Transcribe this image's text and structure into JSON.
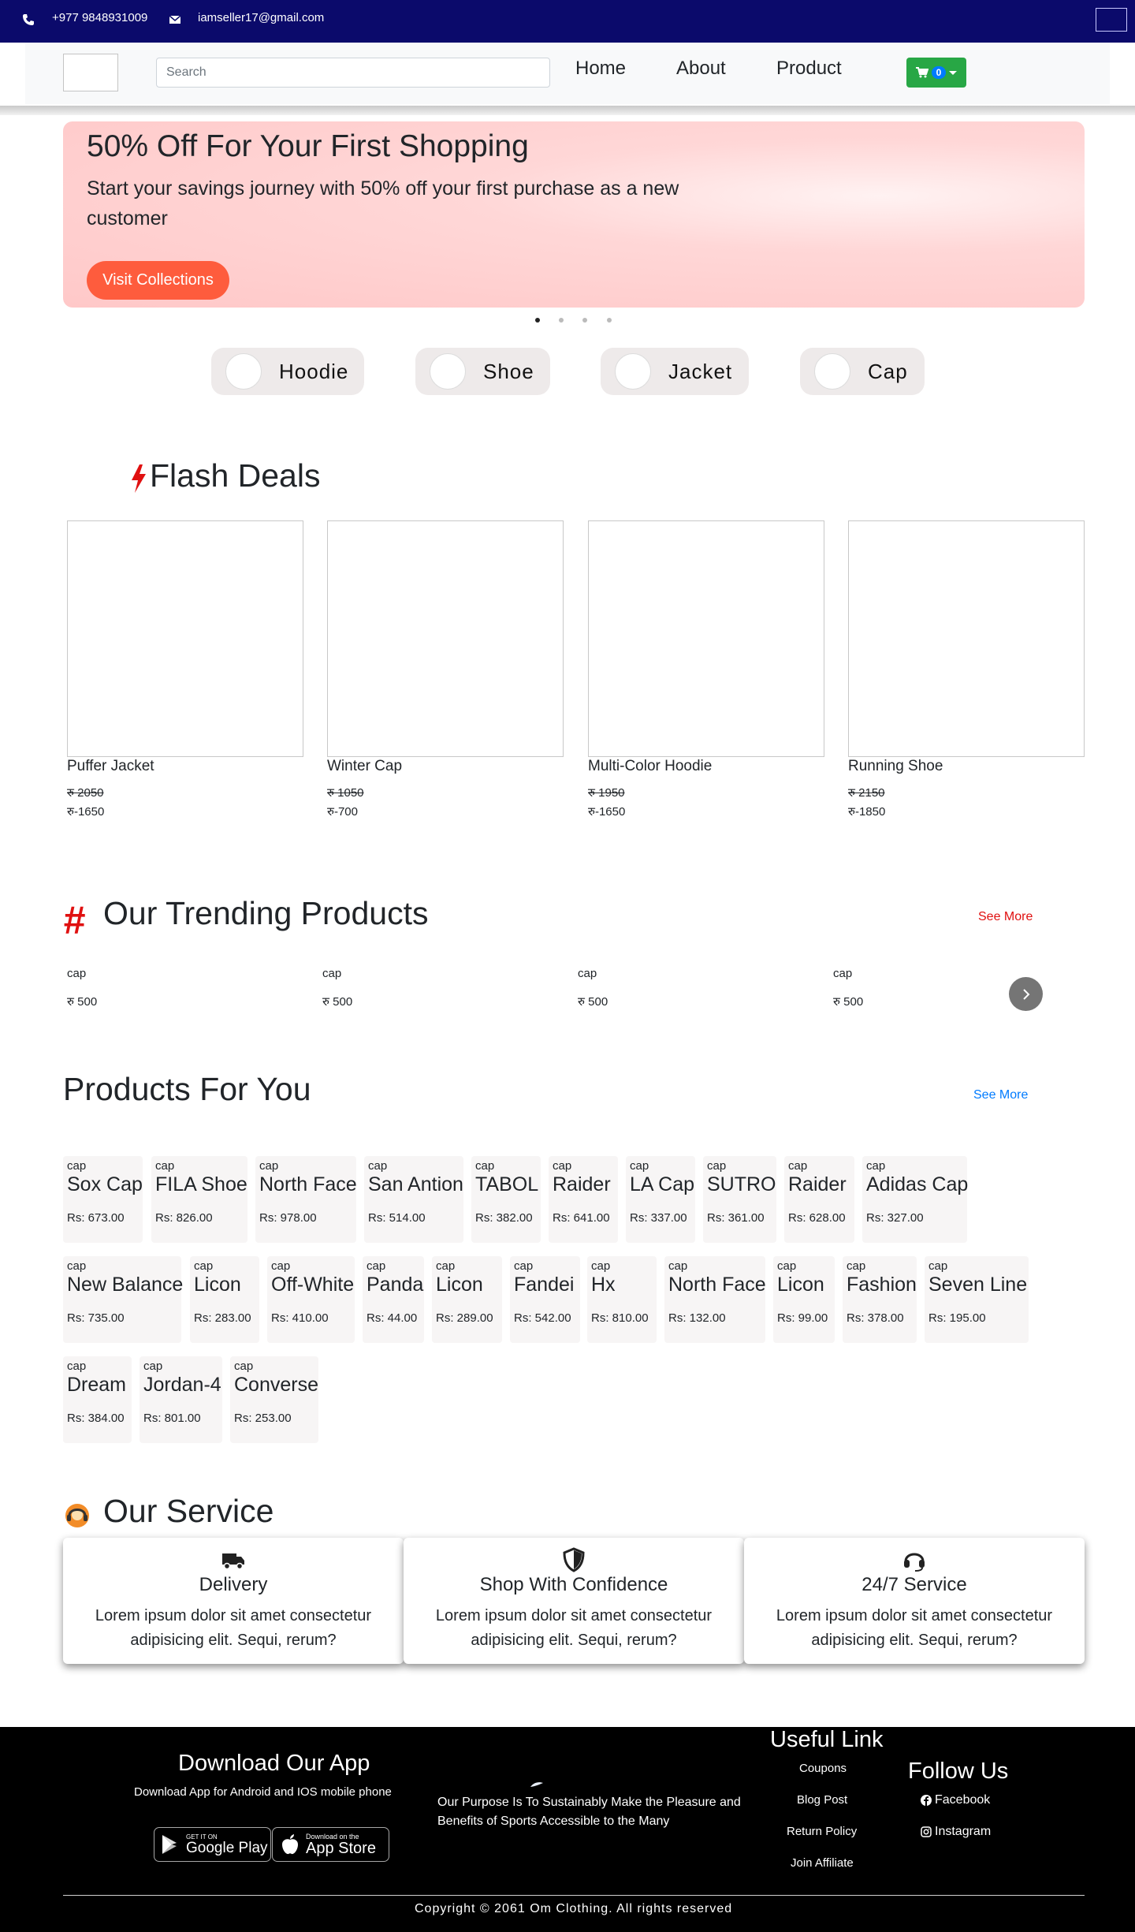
{
  "topbar": {
    "phone": "+977 9848931009",
    "email": "iamseller17@gmail.com"
  },
  "nav": {
    "search_placeholder": "Search",
    "links": [
      "Home",
      "About",
      "Product"
    ],
    "cart_count": "0"
  },
  "hero": {
    "title": "50% Off For Your First Shopping",
    "subtitle": "Start your savings journey with 50% off your first purchase as a new customer",
    "button": "Visit Collections",
    "slide_count": 4,
    "active_slide": 1
  },
  "categories": [
    "Hoodie",
    "Shoe",
    "Jacket",
    "Cap"
  ],
  "flash_deals": {
    "title": "Flash Deals",
    "items": [
      {
        "name": "Puffer Jacket",
        "old_price": "रु 2050",
        "new_price": "रु-1650"
      },
      {
        "name": "Winter Cap",
        "old_price": "रु 1050",
        "new_price": "रु-700"
      },
      {
        "name": "Multi-Color Hoodie",
        "old_price": "रु 1950",
        "new_price": "रु-1650"
      },
      {
        "name": "Running Shoe",
        "old_price": "रु 2150",
        "new_price": "रु-1850"
      }
    ]
  },
  "trending": {
    "hash": "#",
    "title": "Our Trending Products",
    "see_more": "See More",
    "items": [
      {
        "alt": "cap",
        "price": "रु 500"
      },
      {
        "alt": "cap",
        "price": "रु 500"
      },
      {
        "alt": "cap",
        "price": "रु 500"
      },
      {
        "alt": "cap",
        "price": "रु 500"
      }
    ]
  },
  "for_you": {
    "title": "Products For You",
    "see_more": "See More",
    "rows": [
      [
        {
          "alt": "cap",
          "name": "Sox Cap",
          "price": "Rs: 673.00"
        },
        {
          "alt": "cap",
          "name": "FILA Shoe",
          "price": "Rs: 826.00"
        },
        {
          "alt": "cap",
          "name": "North Face",
          "price": "Rs: 978.00"
        },
        {
          "alt": "cap",
          "name": "San Antion",
          "price": "Rs: 514.00"
        },
        {
          "alt": "cap",
          "name": "TABOL",
          "price": "Rs: 382.00"
        },
        {
          "alt": "cap",
          "name": "Raider",
          "price": "Rs: 641.00"
        },
        {
          "alt": "cap",
          "name": "LA Cap",
          "price": "Rs: 337.00"
        },
        {
          "alt": "cap",
          "name": "SUTRO",
          "price": "Rs: 361.00"
        },
        {
          "alt": "cap",
          "name": "Raider",
          "price": "Rs: 628.00"
        },
        {
          "alt": "cap",
          "name": "Adidas Cap",
          "price": "Rs: 327.00"
        }
      ],
      [
        {
          "alt": "cap",
          "name": "New Balance",
          "price": "Rs: 735.00"
        },
        {
          "alt": "cap",
          "name": "Licon",
          "price": "Rs: 283.00"
        },
        {
          "alt": "cap",
          "name": "Off-White",
          "price": "Rs: 410.00"
        },
        {
          "alt": "cap",
          "name": "Panda",
          "price": "Rs: 44.00"
        },
        {
          "alt": "cap",
          "name": "Licon",
          "price": "Rs: 289.00"
        },
        {
          "alt": "cap",
          "name": "Fandei",
          "price": "Rs: 542.00"
        },
        {
          "alt": "cap",
          "name": "Hx",
          "price": "Rs: 810.00"
        },
        {
          "alt": "cap",
          "name": "North Face",
          "price": "Rs: 132.00"
        },
        {
          "alt": "cap",
          "name": "Licon",
          "price": "Rs: 99.00"
        },
        {
          "alt": "cap",
          "name": "Fashion",
          "price": "Rs: 378.00"
        },
        {
          "alt": "cap",
          "name": "Seven Line",
          "price": "Rs: 195.00"
        }
      ],
      [
        {
          "alt": "cap",
          "name": "Dream",
          "price": "Rs: 384.00"
        },
        {
          "alt": "cap",
          "name": "Jordan-4",
          "price": "Rs: 801.00"
        },
        {
          "alt": "cap",
          "name": "Converse",
          "price": "Rs: 253.00"
        }
      ]
    ]
  },
  "service": {
    "title": "Our Service",
    "cards": [
      {
        "title": "Delivery",
        "desc": "Lorem ipsum dolor sit amet consectetur adipisicing elit. Sequi, rerum?",
        "icon": "truck-icon"
      },
      {
        "title": "Shop With Confidence",
        "desc": "Lorem ipsum dolor sit amet consectetur adipisicing elit. Sequi, rerum?",
        "icon": "shield-icon"
      },
      {
        "title": "24/7 Service",
        "desc": "Lorem ipsum dolor sit amet consectetur adipisicing elit. Sequi, rerum?",
        "icon": "headset-icon"
      }
    ]
  },
  "footer": {
    "download_title": "Download Our App",
    "download_sub": "Download App for Android and IOS mobile phone",
    "google_small": "GET IT ON",
    "google_big": "Google Play",
    "apple_small": "Download on the",
    "apple_big": "App Store",
    "purpose": "Our Purpose Is To Sustainably Make the Pleasure and Benefits of Sports Accessible to the Many",
    "useful_title": "Useful Link",
    "useful_links": [
      "Coupons",
      "Blog Post",
      "Return Policy",
      "Join Affiliate"
    ],
    "follow_title": "Follow Us",
    "social": [
      "Facebook",
      "Instagram"
    ],
    "copyright": "Copyright © 2061 Om Clothing. All rights reserved"
  },
  "colors": {
    "topbar": "#0b0a6b",
    "accent_orange": "#fe5c3d",
    "cart_green": "#28a745",
    "see_more_red": "#e01010",
    "see_more_blue": "#007bff"
  }
}
